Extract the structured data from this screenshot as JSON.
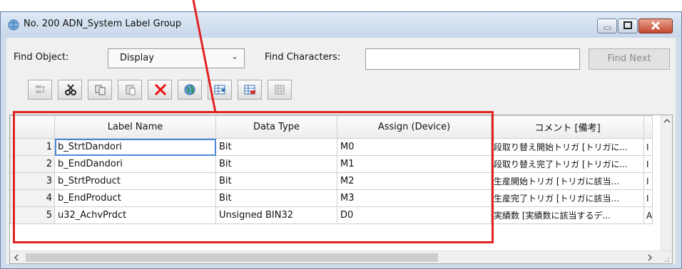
{
  "window": {
    "title": "No. 200 ADN_System Label Group"
  },
  "find": {
    "object_label": "Find Object:",
    "object_value": "Display",
    "characters_label": "Find Characters:",
    "characters_value": "",
    "find_next_label": "Find Next"
  },
  "toolbar": {
    "icons": [
      "insert-rows-icon",
      "cut-icon",
      "copy-icon",
      "paste-icon",
      "delete-icon",
      "globe-icon",
      "import-icon",
      "export-icon",
      "grid-icon"
    ]
  },
  "grid": {
    "headers": [
      "Label Name",
      "Data Type",
      "Assign (Device)",
      "コメント [備考]"
    ],
    "rows": [
      {
        "num": "1",
        "label": "b_StrtDandori",
        "type": "Bit",
        "device": "M0",
        "comment": "段取り替え開始トリガ [トリガに...",
        "extra": "I"
      },
      {
        "num": "2",
        "label": "b_EndDandori",
        "type": "Bit",
        "device": "M1",
        "comment": "段取り替え完了トリガ [トリガに...",
        "extra": "I"
      },
      {
        "num": "3",
        "label": "b_StrtProduct",
        "type": "Bit",
        "device": "M2",
        "comment": "生産開始トリガ [トリガに該当...",
        "extra": "I"
      },
      {
        "num": "4",
        "label": "b_EndProduct",
        "type": "Bit",
        "device": "M3",
        "comment": "生産完了トリガ [トリガに該当...",
        "extra": "I"
      },
      {
        "num": "5",
        "label": "u32_AchvPrdct",
        "type": "Unsigned BIN32",
        "device": "D0",
        "comment": "実績数 [実績数に該当するデ...",
        "extra": "A"
      }
    ]
  },
  "colors": {
    "highlight": "#e12222",
    "selection": "#4a8ad8"
  }
}
